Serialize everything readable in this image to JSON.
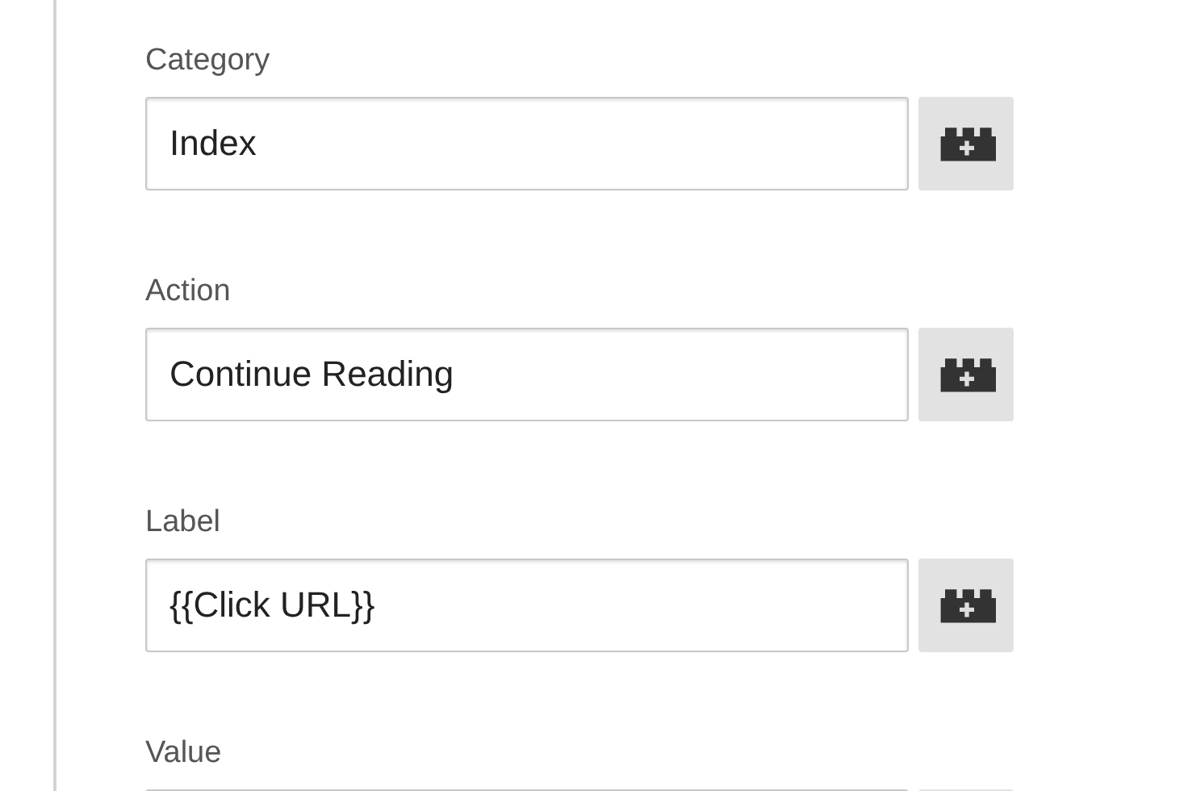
{
  "fields": [
    {
      "label": "Category",
      "value": "Index"
    },
    {
      "label": "Action",
      "value": "Continue Reading"
    },
    {
      "label": "Label",
      "value": "{{Click URL}}"
    },
    {
      "label": "Value"
    }
  ]
}
